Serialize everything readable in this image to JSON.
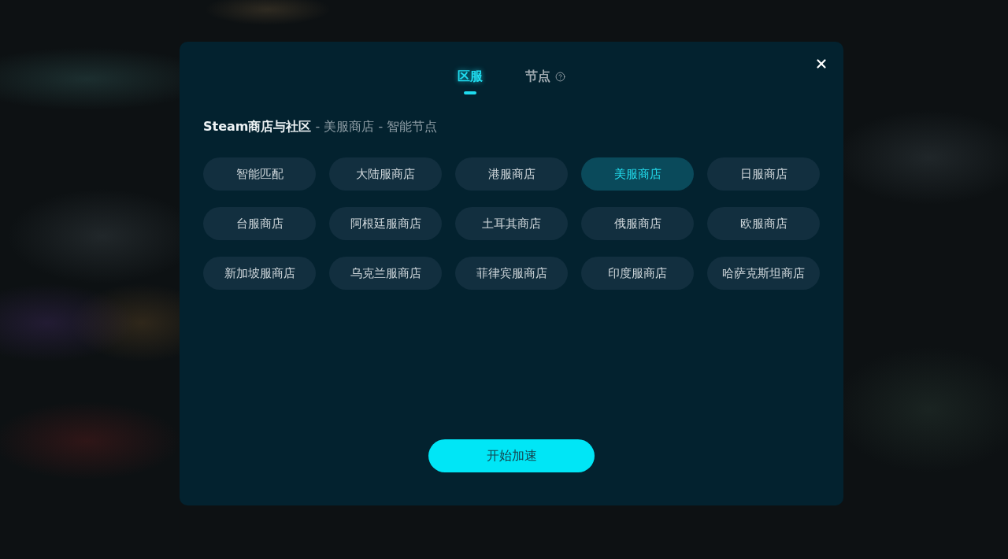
{
  "dialog": {
    "tabs": [
      {
        "label": "区服",
        "selected": true,
        "help_icon": false
      },
      {
        "label": "节点",
        "selected": false,
        "help_icon": true
      }
    ],
    "breadcrumb": {
      "title": "Steam商店与社区",
      "path": "- 美服商店 - 智能节点"
    },
    "regions": [
      {
        "label": "智能匹配",
        "selected": false
      },
      {
        "label": "大陆服商店",
        "selected": false
      },
      {
        "label": "港服商店",
        "selected": false
      },
      {
        "label": "美服商店",
        "selected": true
      },
      {
        "label": "日服商店",
        "selected": false
      },
      {
        "label": "台服商店",
        "selected": false
      },
      {
        "label": "阿根廷服商店",
        "selected": false
      },
      {
        "label": "土耳其商店",
        "selected": false
      },
      {
        "label": "俄服商店",
        "selected": false
      },
      {
        "label": "欧服商店",
        "selected": false
      },
      {
        "label": "新加坡服商店",
        "selected": false
      },
      {
        "label": "乌克兰服商店",
        "selected": false
      },
      {
        "label": "菲律宾服商店",
        "selected": false
      },
      {
        "label": "印度服商店",
        "selected": false
      },
      {
        "label": "哈萨克斯坦商店",
        "selected": false
      }
    ],
    "start_button": "开始加速"
  }
}
